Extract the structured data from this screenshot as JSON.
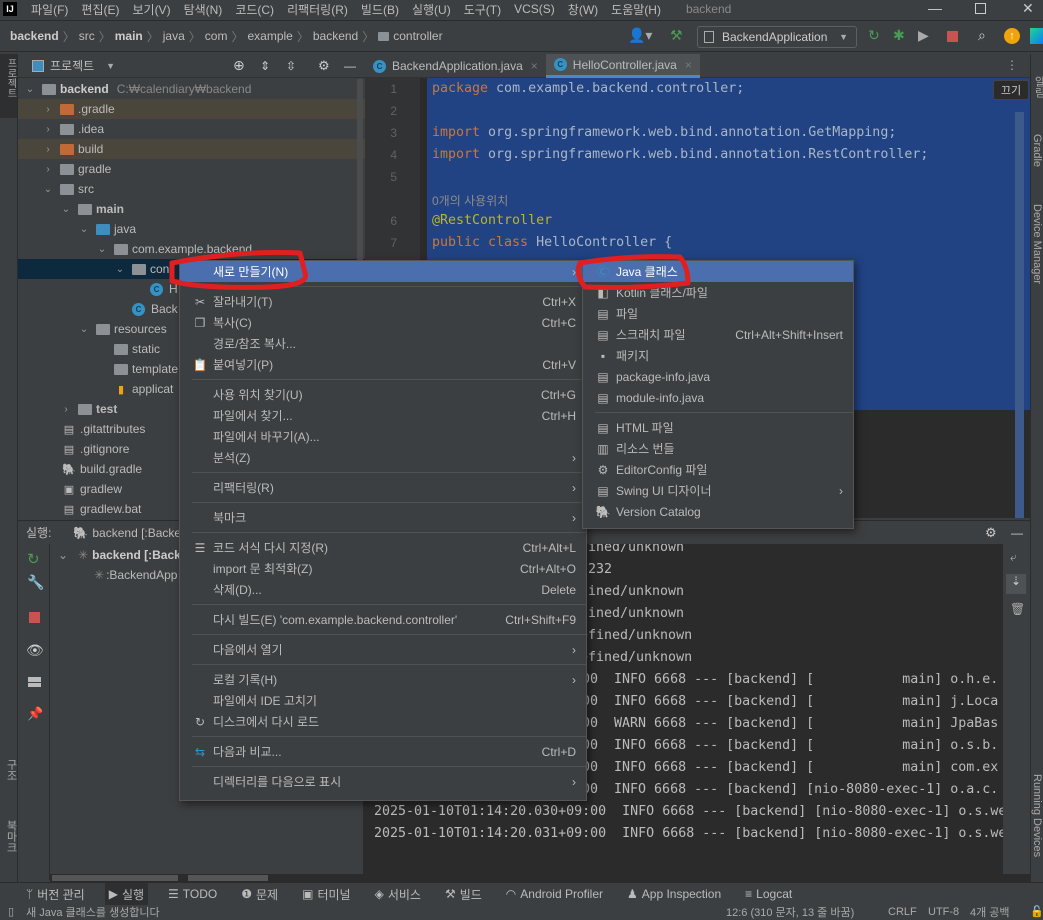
{
  "app": {
    "logo": "IJ",
    "window_title": "backend"
  },
  "menubar": [
    "파일(F)",
    "편집(E)",
    "보기(V)",
    "탐색(N)",
    "코드(C)",
    "리팩터링(R)",
    "빌드(B)",
    "실행(U)",
    "도구(T)",
    "VCS(S)",
    "창(W)",
    "도움말(H)"
  ],
  "breadcrumb": [
    "backend",
    "src",
    "main",
    "java",
    "com",
    "example",
    "backend",
    "controller"
  ],
  "toolbar": {
    "run_config": "BackendApplication"
  },
  "project_panel": {
    "title": "프로젝트",
    "root": {
      "name": "backend",
      "path": "C:₩calendiary₩backend"
    },
    "items": [
      ".gradle",
      ".idea",
      "build",
      "gradle",
      "src",
      "main",
      "java",
      "com.example.backend",
      "con",
      "H",
      "Back",
      "resources",
      "static",
      "template",
      "applicat",
      "test",
      ".gitattributes",
      ".gitignore",
      "build.gradle",
      "gradlew",
      "gradlew.bat"
    ]
  },
  "left_strip": {
    "top": "프로젝트",
    "structure": "구조",
    "bookmarks": "북마크"
  },
  "right_strip": {
    "notifications": "알림",
    "gradle": "Gradle",
    "device_manager": "Device Manager",
    "running_devices": "Running Devices"
  },
  "editor": {
    "tabs": [
      {
        "label": "BackendApplication.java",
        "active": false
      },
      {
        "label": "HelloController.java",
        "active": true
      }
    ],
    "tooltip": "끄기",
    "line_numbers": [
      "1",
      "2",
      "3",
      "4",
      "5",
      "6",
      "7"
    ],
    "lines": {
      "l1_kw": "package",
      "l1_rest": " com.example.backend.controller;",
      "l3_kw": "import",
      "l3_rest": " org.springframework.web.bind.annotation.GetMapping;",
      "l4_kw": "import",
      "l4_rest": " org.springframework.web.bind.annotation.RestController;",
      "usage_hint": "0개의 사용위치",
      "l6": "@RestController",
      "l7_kw": "public class",
      "l7_rest": " HelloController {"
    }
  },
  "run_panel": {
    "label": "실행:",
    "tab": "backend [:Backe",
    "tree": [
      "backend [:Back",
      ":BackendApp"
    ],
    "console_fragments": [
      "ined/unknown",
      "232",
      "ined/unknown",
      "ined/unknown",
      "efined/unknown",
      "efined/unknown"
    ],
    "console_lines": [
      ":00  INFO 6668 --- [backend] [           main] o.h.e.",
      ":00  INFO 6668 --- [backend] [           main] j.Loca",
      ":00  WARN 6668 --- [backend] [           main] JpaBas",
      ":00  INFO 6668 --- [backend] [           main] o.s.b.",
      ":00  INFO 6668 --- [backend] [           main] com.ex",
      ":00  INFO 6668 --- [backend] [nio-8080-exec-1] o.a.c.",
      "2025-01-10T01:14:20.030+09:00  INFO 6668 --- [backend] [nio-8080-exec-1] o.s.we",
      "2025-01-10T01:14:20.031+09:00  INFO 6668 --- [backend] [nio-8080-exec-1] o.s.we"
    ]
  },
  "context_menu": {
    "items": [
      {
        "label": "새로 만들기(N)",
        "submenu": true,
        "highlighted": true
      },
      {
        "sep": true
      },
      {
        "label": "잘라내기(T)",
        "shortcut": "Ctrl+X",
        "icon": "scissors-icon"
      },
      {
        "label": "복사(C)",
        "shortcut": "Ctrl+C",
        "icon": "copy-icon"
      },
      {
        "label": "경로/참조 복사..."
      },
      {
        "label": "붙여넣기(P)",
        "shortcut": "Ctrl+V",
        "icon": "paste-icon"
      },
      {
        "sep": true
      },
      {
        "label": "사용 위치 찾기(U)",
        "shortcut": "Ctrl+G"
      },
      {
        "label": "파일에서 찾기...",
        "shortcut": "Ctrl+H"
      },
      {
        "label": "파일에서 바꾸기(A)..."
      },
      {
        "label": "분석(Z)",
        "submenu": true
      },
      {
        "sep": true
      },
      {
        "label": "리팩터링(R)",
        "submenu": true
      },
      {
        "sep": true
      },
      {
        "label": "북마크",
        "submenu": true
      },
      {
        "sep": true
      },
      {
        "label": "코드 서식 다시 지정(R)",
        "shortcut": "Ctrl+Alt+L",
        "icon": "reformat-icon"
      },
      {
        "label": "import 문 최적화(Z)",
        "shortcut": "Ctrl+Alt+O"
      },
      {
        "label": "삭제(D)...",
        "shortcut": "Delete"
      },
      {
        "sep": true
      },
      {
        "label": "다시 빌드(E) 'com.example.backend.controller'",
        "shortcut": "Ctrl+Shift+F9"
      },
      {
        "sep": true
      },
      {
        "label": "다음에서 열기",
        "submenu": true
      },
      {
        "sep": true
      },
      {
        "label": "로컬 기록(H)",
        "submenu": true
      },
      {
        "label": "파일에서 IDE 고치기"
      },
      {
        "label": "디스크에서 다시 로드",
        "icon": "reload-icon"
      },
      {
        "sep": true
      },
      {
        "label": "다음과 비교...",
        "shortcut": "Ctrl+D",
        "icon": "compare-icon"
      },
      {
        "sep": true
      },
      {
        "label": "디렉터리를 다음으로 표시",
        "submenu": true
      }
    ]
  },
  "new_submenu": {
    "items": [
      {
        "label": "Java 클래스",
        "highlighted": true,
        "icon": "java-class-icon"
      },
      {
        "label": "Kotlin 클래스/파일",
        "icon": "kotlin-file-icon"
      },
      {
        "label": "파일",
        "icon": "file-icon"
      },
      {
        "label": "스크래치 파일",
        "shortcut": "Ctrl+Alt+Shift+Insert",
        "icon": "scratch-file-icon"
      },
      {
        "label": "패키지",
        "icon": "package-icon"
      },
      {
        "label": "package-info.java",
        "icon": "java-file-icon"
      },
      {
        "label": "module-info.java",
        "icon": "java-file-icon"
      },
      {
        "sep": true
      },
      {
        "label": "HTML 파일",
        "icon": "html-file-icon"
      },
      {
        "label": "리소스 번들",
        "icon": "resource-bundle-icon"
      },
      {
        "label": "EditorConfig 파일",
        "icon": "gear-icon"
      },
      {
        "label": "Swing UI 디자이너",
        "submenu": true,
        "icon": "form-icon"
      },
      {
        "label": "Version Catalog",
        "icon": "gradle-icon"
      }
    ]
  },
  "bottom_tools": [
    "버전 관리",
    "실행",
    "TODO",
    "문제",
    "터미널",
    "서비스",
    "빌드",
    "Android Profiler",
    "App Inspection",
    "Logcat"
  ],
  "status": {
    "message": "새 Java 클래스를 생성합니다",
    "position": "12:6 (310 문자, 13 줄 바꿈)",
    "line_sep": "CRLF",
    "encoding": "UTF-8",
    "indent": "4개 공백"
  },
  "colors": {
    "accent": "#4b6eaf",
    "selection": "#214283",
    "annotation": "#e02020",
    "stop": "#c75450",
    "run": "#499c54"
  }
}
